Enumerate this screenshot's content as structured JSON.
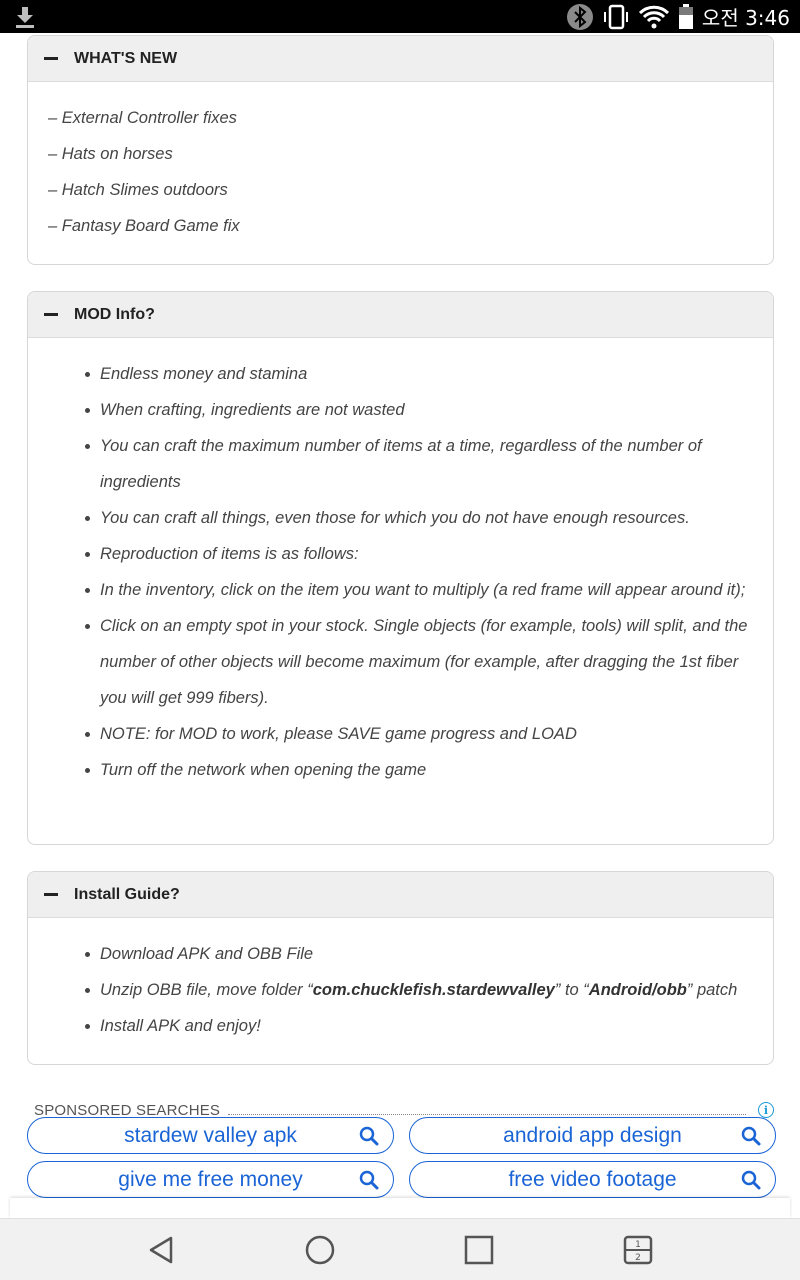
{
  "status_bar": {
    "time": "오전 3:46",
    "icons": [
      "download-icon",
      "bluetooth-icon",
      "vibrate-icon",
      "wifi-icon",
      "battery-icon"
    ]
  },
  "whats_new": {
    "title": "WHAT'S NEW",
    "items": [
      "– External Controller fixes",
      "– Hats on horses",
      "– Hatch Slimes outdoors",
      "– Fantasy Board Game fix"
    ]
  },
  "mod_info": {
    "title": "MOD Info?",
    "items": [
      "Endless money and stamina",
      "When crafting, ingredients are not wasted",
      "You can craft the maximum number of items at a time, regardless of the number of ingredients",
      "You can craft all things, even those for which you do not have enough resources.",
      "Reproduction of items is as follows:",
      "In the inventory, click on the item you want to multiply (a red frame will appear around it);",
      "Click on an empty spot in your stock. Single objects (for example, tools) will split, and the number of other objects will become maximum (for example, after dragging the 1st fiber you will get 999 fibers).",
      "NOTE: for MOD to work, please SAVE game progress and LOAD",
      "Turn off the network when opening the game"
    ]
  },
  "install_guide": {
    "title": "Install Guide?",
    "item1": "Download APK and OBB File",
    "item2_prefix": "Unzip OBB file, move folder “",
    "item2_bold1": "com.chucklefish.stardewvalley",
    "item2_mid": "” to “",
    "item2_bold2": "Android/obb",
    "item2_suffix": "” patch",
    "item3": "Install APK and enjoy!"
  },
  "sponsored": {
    "label": "SPONSORED SEARCHES",
    "searches": [
      "stardew valley apk",
      "android app design",
      "give me free money",
      "free video footage"
    ]
  },
  "colors": {
    "link_blue": "#1a64d6",
    "info_blue": "#1a9bd7"
  }
}
